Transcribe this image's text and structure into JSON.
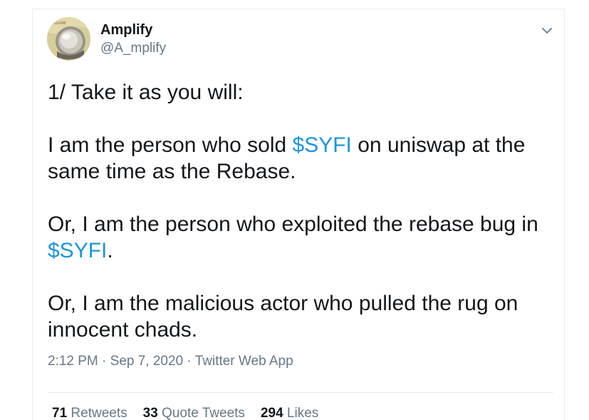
{
  "author": {
    "name": "Amplify",
    "handle": "@A_mplify"
  },
  "tweet": {
    "line1": "1/ Take it as you will:",
    "para2_pre": "I am the person who sold ",
    "para2_tag": "$SYFI",
    "para2_post": " on uniswap at the same time as the Rebase.",
    "para3_pre": "Or, I am the person who exploited the rebase bug in ",
    "para3_tag": "$SYFI",
    "para3_post": ".",
    "para4": "Or, I am the malicious actor who pulled the rug on innocent chads."
  },
  "meta": {
    "time": "2:12 PM",
    "sep1": " · ",
    "date": "Sep 7, 2020",
    "sep2": " · ",
    "source": "Twitter Web App"
  },
  "stats": {
    "retweets_count": "71",
    "retweets_label": " Retweets",
    "quotes_count": "33",
    "quotes_label": " Quote Tweets",
    "likes_count": "294",
    "likes_label": " Likes"
  },
  "colors": {
    "link": "#1b95e0",
    "secondary": "#657786",
    "text": "#14171a",
    "border": "#e6ecf0"
  },
  "icons": {
    "caret": "chevron-down-icon",
    "avatar": "volume-knob-avatar"
  }
}
